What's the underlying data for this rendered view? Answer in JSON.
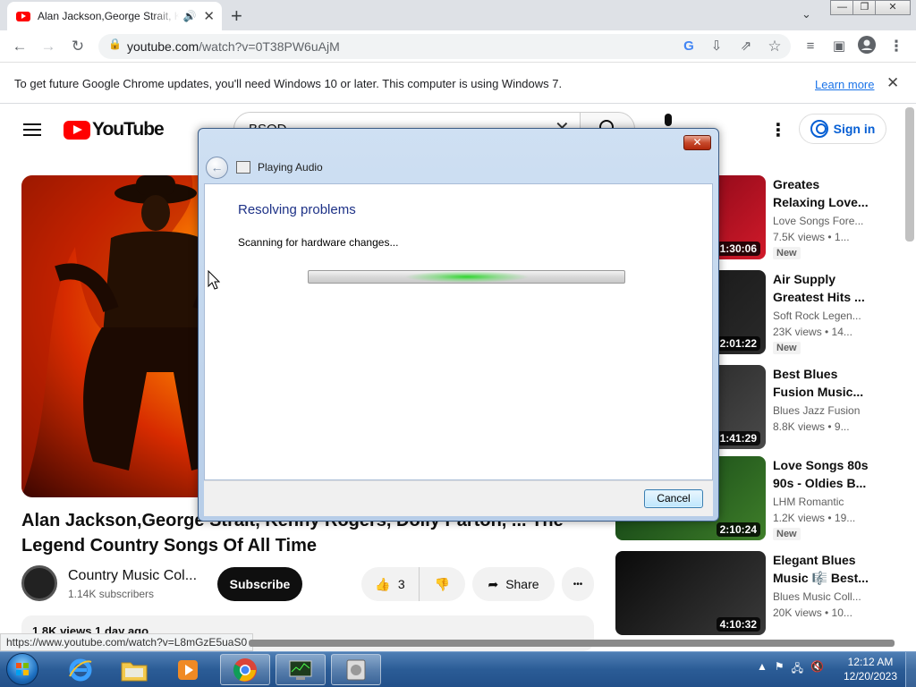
{
  "browser": {
    "tab_title": "Alan Jackson,George Strait, K",
    "tab_close": "✕",
    "new_tab": "+",
    "tab_dropdown": "⌄",
    "win_minimize": "—",
    "win_restore": "❐",
    "win_close": "✕",
    "url_host": "youtube.com",
    "url_path": "/watch?v=0T38PW6uAjM",
    "status_url": "https://www.youtube.com/watch?v=L8mGzE5uaS0"
  },
  "infobar": {
    "text": "To get future Google Chrome updates, you'll need Windows 10 or later. This computer is using Windows 7.",
    "link": "Learn more",
    "close": "✕"
  },
  "youtube": {
    "logo_text": "YouTube",
    "search_value": "BSOD",
    "signin_label": "Sign in",
    "video_title": "Alan Jackson,George Strait, Kenny Rogers, Dolly Parton, ... The Legend Country Songs Of All Time",
    "channel_name": "Country Music Col...",
    "subscribers": "1.14K subscribers",
    "subscribe_label": "Subscribe",
    "like_count": "3",
    "share_label": "Share",
    "more_label": "•••",
    "description_stats": "1.8K views  1 day ago"
  },
  "recommendations": [
    {
      "title": "Greates\nRelaxing Love...",
      "channel": "Love Songs Fore...",
      "meta": "7.5K views  •  1...",
      "badge": "New",
      "duration": "1:30:06",
      "colors": [
        "#6a0010",
        "#d11a2a"
      ]
    },
    {
      "title": "Air Supply\nGreatest Hits ...",
      "channel": "Soft Rock Legen...",
      "meta": "23K views  •  14...",
      "badge": "New",
      "duration": "2:01:22",
      "colors": [
        "#111111",
        "#2a2a2a"
      ]
    },
    {
      "title": "Best Blues\nFusion Music...",
      "channel": "Blues Jazz Fusion",
      "meta": "8.8K views  •  9...",
      "badge": "",
      "duration": "1:41:29",
      "colors": [
        "#1a1a1a",
        "#4a4a4a"
      ]
    },
    {
      "title": "Love Songs 80s\n90s - Oldies B...",
      "channel": "LHM Romantic",
      "meta": "1.2K views  •  19...",
      "badge": "New",
      "duration": "2:10:24",
      "colors": [
        "#0d3a12",
        "#3f7f2a"
      ]
    },
    {
      "title": "Elegant Blues\nMusic 🎼 Best...",
      "channel": "Blues Music Coll...",
      "meta": "20K views  •  10...",
      "badge": "",
      "duration": "4:10:32",
      "colors": [
        "#0a0a0a",
        "#3a3a3a"
      ]
    }
  ],
  "dialog": {
    "window_title": "Playing Audio",
    "heading": "Resolving problems",
    "status": "Scanning for hardware changes...",
    "progress_state": "indeterminate",
    "cancel_label": "Cancel",
    "close": "✕"
  },
  "taskbar": {
    "time": "12:12 AM",
    "date": "12/20/2023",
    "items": [
      "internet-explorer",
      "file-explorer",
      "media-player",
      "chrome",
      "task-manager",
      "troubleshooter"
    ]
  },
  "colors": {
    "youtube_red": "#ff0000",
    "link_blue": "#1a73e8",
    "signin_blue": "#065fd4",
    "dialog_heading": "#1e3287"
  }
}
